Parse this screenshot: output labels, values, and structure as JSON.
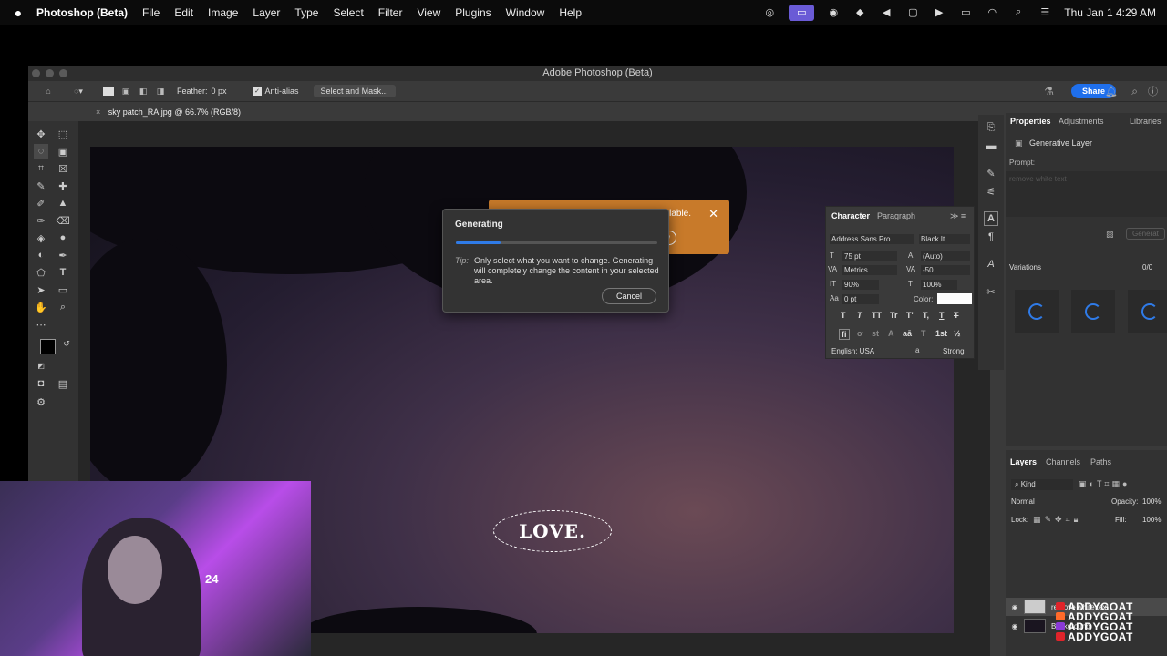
{
  "menubar": {
    "app_name": "Photoshop (Beta)",
    "items": [
      "File",
      "Edit",
      "Image",
      "Layer",
      "Type",
      "Select",
      "Filter",
      "View",
      "Plugins",
      "Window",
      "Help"
    ],
    "clock": "Thu Jan 1  4:29 AM"
  },
  "window": {
    "title": "Adobe Photoshop (Beta)"
  },
  "options": {
    "feather_label": "Feather:",
    "feather_value": "0 px",
    "antialias_label": "Anti-alias",
    "select_mask": "Select and Mask...",
    "share": "Share"
  },
  "document": {
    "tab": "sky patch_RA.jpg @ 66.7% (RGB/8)",
    "canvas_text": "LOVE."
  },
  "notice": {
    "text": "lable.",
    "button": "w"
  },
  "dialog": {
    "title": "Generating",
    "progress": 0.22,
    "tip_label": "Tip:",
    "tip_text": "Only select what you want to change. Generating will completely change the content in your selected area.",
    "cancel": "Cancel"
  },
  "character": {
    "tabs": [
      "Character",
      "Paragraph"
    ],
    "font_family": "Address Sans Pro",
    "font_style": "Black It",
    "size": "75 pt",
    "leading": "(Auto)",
    "kerning": "Metrics",
    "tracking": "-50",
    "vscale": "90%",
    "hscale": "100%",
    "baseline": "0 pt",
    "color_label": "Color:",
    "language": "English: USA",
    "aa_label": "a",
    "aa": "Strong"
  },
  "properties": {
    "tabs": [
      "Properties",
      "Adjustments",
      "Libraries"
    ],
    "layer_type": "Generative Layer",
    "prompt_label": "Prompt:",
    "prompt_value": "remove white text",
    "generate": "Generat",
    "variations_label": "Variations",
    "variations_count": "0/0"
  },
  "layers": {
    "tabs": [
      "Layers",
      "Channels",
      "Paths"
    ],
    "kind": "Kind",
    "blend": "Normal",
    "opacity_label": "Opacity:",
    "opacity": "100%",
    "lock_label": "Lock:",
    "fill_label": "Fill:",
    "fill": "100%",
    "items": [
      "remove white text",
      "Background"
    ]
  },
  "webcam": {
    "jersey_number": "24"
  },
  "watermark": {
    "handle": "ADDYGOAT",
    "icon_colors": [
      "#e0242a",
      "#ff6a2a",
      "#8a3ad8",
      "#e0242a"
    ]
  }
}
